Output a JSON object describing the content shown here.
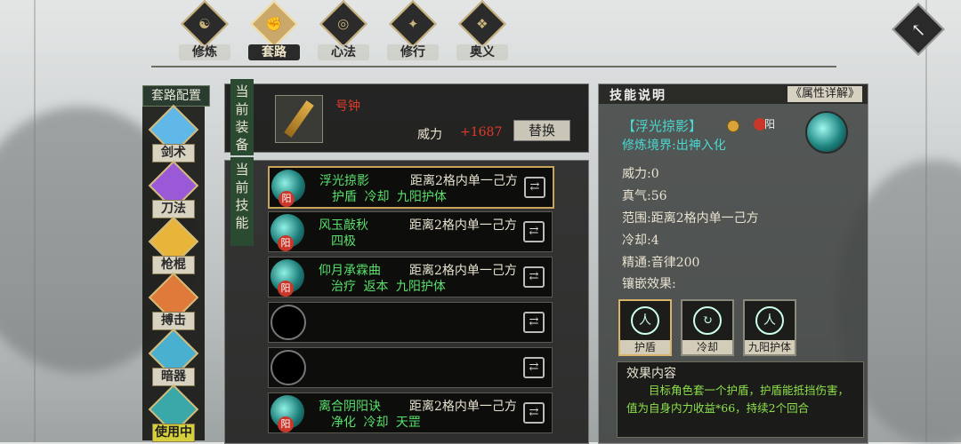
{
  "tabs": [
    {
      "label": "修炼",
      "glyph": "☯",
      "active": false
    },
    {
      "label": "套路",
      "glyph": "✊",
      "active": true
    },
    {
      "label": "心法",
      "glyph": "◎",
      "active": false
    },
    {
      "label": "修行",
      "glyph": "✦",
      "active": false
    },
    {
      "label": "奥义",
      "glyph": "❖",
      "active": false
    }
  ],
  "sidebar": {
    "title": "套路配置",
    "categories": [
      {
        "label": "剑术",
        "color": "#5fb8e8"
      },
      {
        "label": "刀法",
        "color": "#9a5ad8"
      },
      {
        "label": "枪棍",
        "color": "#e8b53a"
      },
      {
        "label": "搏击",
        "color": "#e07a3a"
      },
      {
        "label": "暗器",
        "color": "#4ab0d0"
      },
      {
        "label": "使用中",
        "color": "#3aa8a8"
      }
    ]
  },
  "equipment": {
    "header": "当前装备",
    "item_name": "号钟",
    "power_label": "威力",
    "power_value": "+1687",
    "replace_label": "替换"
  },
  "skills": {
    "header": "当前技能",
    "rows": [
      {
        "name": "浮光掠影",
        "range": "距离2格内单一己方",
        "tags": "护盾 冷却 九阳护体",
        "badge": "阳",
        "empty": false
      },
      {
        "name": "风玉敲秋",
        "range": "距离2格内单一己方",
        "tags": "四极",
        "badge": "阳",
        "empty": false
      },
      {
        "name": "仰月承霖曲",
        "range": "距离2格内单一己方",
        "tags": "治疗 返本 九阳护体",
        "badge": "阳",
        "empty": false
      },
      {
        "name": "",
        "range": "",
        "tags": "",
        "badge": "",
        "empty": true
      },
      {
        "name": "",
        "range": "",
        "tags": "",
        "badge": "",
        "empty": true
      },
      {
        "name": "离合阴阳诀",
        "range": "距离2格内单一己方",
        "tags": "净化 冷却 天罡",
        "badge": "阳",
        "empty": false
      }
    ]
  },
  "description": {
    "header": "技能说明",
    "attr_button": "《属性详解》",
    "skill_title": "【浮光掠影】",
    "yang_label": "阳",
    "realm": "修炼境界:出神入化",
    "stats": [
      {
        "label": "威力:",
        "value": "0"
      },
      {
        "label": "真气:",
        "value": "56"
      },
      {
        "label": "范围:",
        "value": "距离2格内单一己方"
      },
      {
        "label": "冷却:",
        "value": "4"
      },
      {
        "label": "精通:",
        "value": "音律200"
      }
    ],
    "inlay_title": "镶嵌效果:",
    "inlays": [
      {
        "label": "护盾",
        "symbol": "人"
      },
      {
        "label": "冷却",
        "symbol": "↻"
      },
      {
        "label": "九阳护体",
        "symbol": "人"
      }
    ],
    "effect_title": "效果内容",
    "effect_text": "目标角色套一个护盾，护盾能抵挡伤害，值为自身内力收益*66，持续2个回合"
  }
}
